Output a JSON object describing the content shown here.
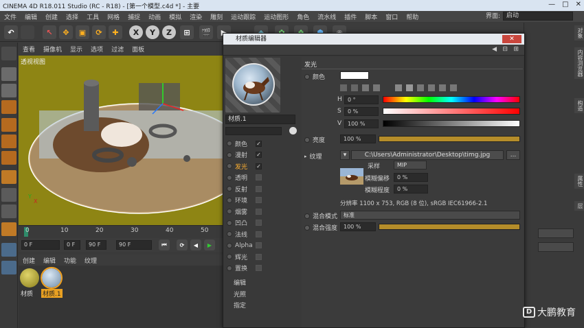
{
  "window": {
    "title": "CINEMA 4D R18.011 Studio (RC - R18) - [第一个模型.c4d *] - 主要"
  },
  "menubar": [
    "文件",
    "编辑",
    "创建",
    "选择",
    "工具",
    "网格",
    "捕捉",
    "动画",
    "模拟",
    "渲染",
    "雕刻",
    "运动跟踪",
    "运动图形",
    "角色",
    "流水线",
    "插件",
    "脚本",
    "窗口",
    "帮助"
  ],
  "layout": {
    "label": "界面:",
    "value": "启动"
  },
  "viewport": {
    "menu": [
      "查看",
      "摄像机",
      "显示",
      "选项",
      "过滤",
      "面板"
    ],
    "label": "透视视图"
  },
  "timeline": {
    "ticks": [
      "0",
      "10",
      "20",
      "30",
      "40",
      "50"
    ],
    "start_field": "0 F",
    "current_field": "0 F",
    "end_field": "90 F",
    "max_field": "90 F"
  },
  "material_manager": {
    "menu": [
      "创建",
      "编辑",
      "功能",
      "纹理"
    ],
    "materials": [
      {
        "label": "材质",
        "color": "#a59a2a"
      },
      {
        "label": "材质.1",
        "color": "#8aa6c2"
      }
    ]
  },
  "editor": {
    "title": "材质编辑器",
    "material_name": "材质.1",
    "channels": [
      {
        "label": "颜色",
        "checked": true,
        "active": false
      },
      {
        "label": "漫射",
        "checked": true,
        "active": false
      },
      {
        "label": "发光",
        "checked": true,
        "active": true
      },
      {
        "label": "透明",
        "checked": false,
        "active": false
      },
      {
        "label": "反射",
        "checked": false,
        "active": false
      },
      {
        "label": "环境",
        "checked": false,
        "active": false
      },
      {
        "label": "烟雾",
        "checked": false,
        "active": false
      },
      {
        "label": "凹凸",
        "checked": false,
        "active": false
      },
      {
        "label": "法线",
        "checked": false,
        "active": false
      },
      {
        "label": "Alpha",
        "checked": false,
        "active": false
      },
      {
        "label": "辉光",
        "checked": false,
        "active": false
      },
      {
        "label": "置换",
        "checked": false,
        "active": false
      }
    ],
    "extra_items": [
      "编辑",
      "光照",
      "指定"
    ],
    "section_title": "发光",
    "color_label": "颜色",
    "h_label": "H",
    "h_value": "0 °",
    "s_label": "S",
    "s_value": "0 %",
    "v_label": "V",
    "v_value": "100 %",
    "brightness_label": "亮度",
    "brightness_value": "100 %",
    "brightness_level": 1.0,
    "texture_label": "纹理",
    "texture_path": "C:\\Users\\Administrator\\Desktop\\timg.jpg",
    "texture_more": "...",
    "sampling_label": "采样",
    "sampling_value": "MIP",
    "blur_offset_label": "模糊偏移",
    "blur_offset_value": "0 %",
    "blur_scale_label": "模糊程度",
    "blur_scale_value": "0 %",
    "resolution": "分辨率 1100 x 753, RGB (8 位), sRGB IEC61966-2.1",
    "mix_mode_label": "混合模式",
    "mix_mode_value": "标准",
    "mix_strength_label": "混合强度",
    "mix_strength_value": "100 %",
    "mix_strength_level": 1.0
  },
  "right_tabs": [
    "对象",
    "内容浏览器",
    "构造",
    "属性",
    "层"
  ],
  "watermark": "大鹏教育"
}
